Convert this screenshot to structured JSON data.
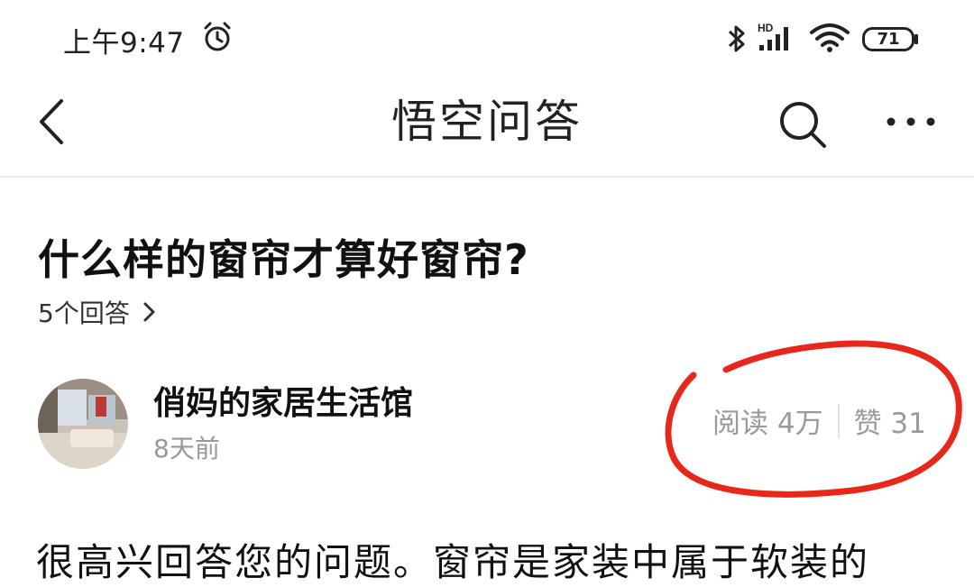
{
  "status_bar": {
    "time": "上午9:47",
    "battery": "71",
    "icons": [
      "alarm-icon",
      "bluetooth-icon",
      "hd-signal-icon",
      "wifi-icon",
      "battery-icon"
    ]
  },
  "nav": {
    "title": "悟空问答",
    "icons": [
      "back-arrow-icon",
      "search-icon",
      "more-icon"
    ]
  },
  "question": {
    "title": "什么样的窗帘才算好窗帘?",
    "answer_count": "5个回答"
  },
  "author": {
    "name": "俏妈的家居生活馆",
    "time": "8天前",
    "reads": "阅读 4万",
    "likes": "赞 31"
  },
  "answer": {
    "text": "很高兴回答您的问题。窗帘是家装中属于软装的"
  },
  "colors": {
    "annotation": "#e8271b",
    "muted_text": "#999999"
  }
}
